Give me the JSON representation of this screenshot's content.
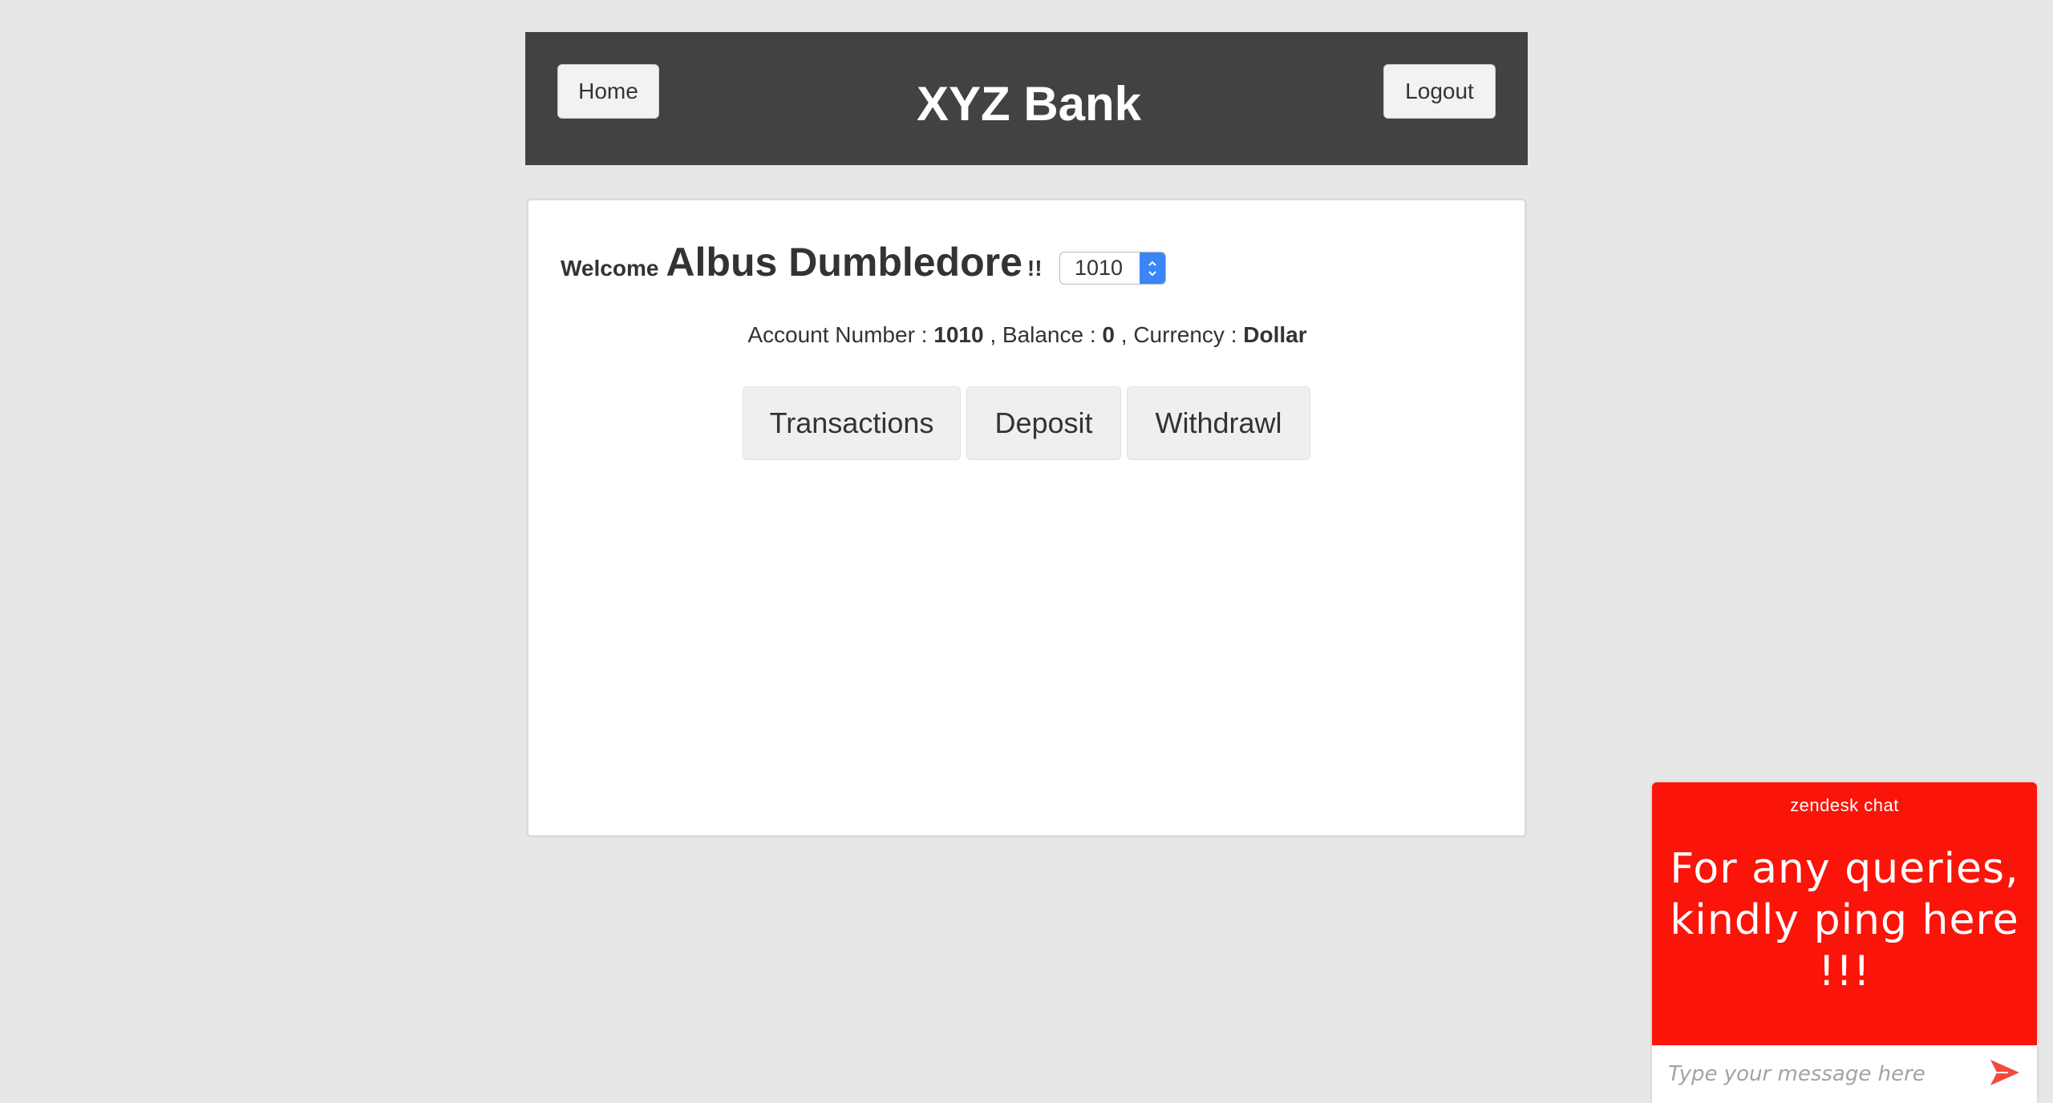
{
  "header": {
    "home_label": "Home",
    "title": "XYZ Bank",
    "logout_label": "Logout"
  },
  "customer": {
    "welcome_label": "Welcome",
    "name": "Albus Dumbledore",
    "exclaim": "!!",
    "account_select": {
      "selected": "1010"
    }
  },
  "account_info": {
    "account_number_label": "Account Number :",
    "account_number": "1010",
    "balance_label": ", Balance :",
    "balance": "0",
    "currency_label": ", Currency :",
    "currency": "Dollar"
  },
  "actions": {
    "transactions_label": "Transactions",
    "deposit_label": "Deposit",
    "withdraw_label": "Withdrawl"
  },
  "chat": {
    "brand": "zendesk chat",
    "message": "For any queries, kindly ping here !!!",
    "input_placeholder": "Type your message here",
    "accent_color": "#fa1409",
    "send_icon": "send-icon"
  }
}
